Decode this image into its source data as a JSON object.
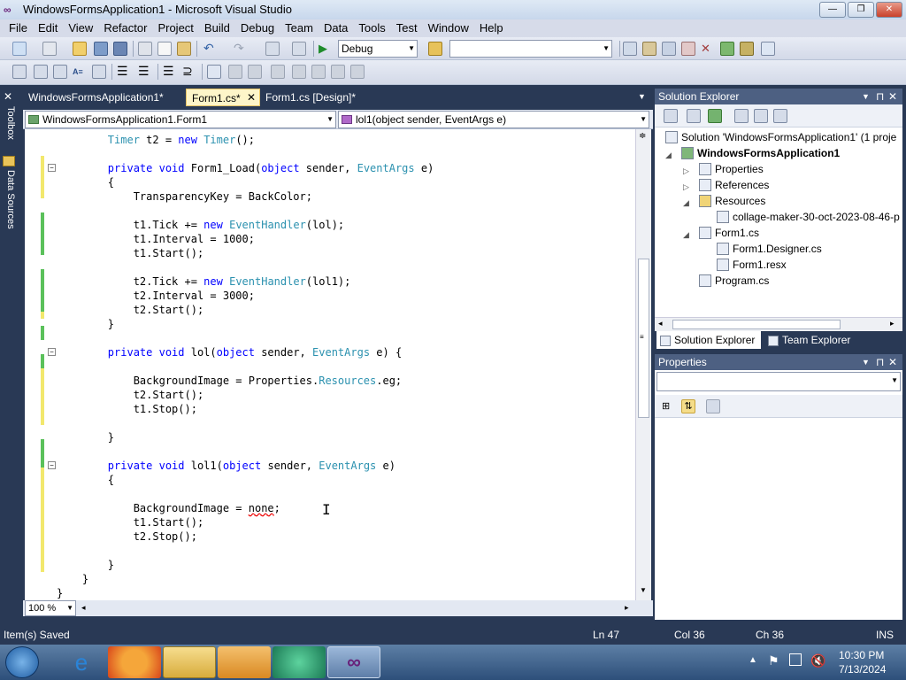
{
  "window": {
    "title": "WindowsFormsApplication1 - Microsoft Visual Studio"
  },
  "menu": [
    "File",
    "Edit",
    "View",
    "Refactor",
    "Project",
    "Build",
    "Debug",
    "Team",
    "Data",
    "Tools",
    "Test",
    "Window",
    "Help"
  ],
  "toolbar": {
    "config": "Debug",
    "platform": ""
  },
  "sidebar": {
    "toolbox": "Toolbox",
    "datasources": "Data Sources"
  },
  "tabs": [
    "WindowsFormsApplication1*",
    "Form1.cs*",
    "Form1.cs [Design]*"
  ],
  "navbar": {
    "class": "WindowsFormsApplication1.Form1",
    "member": "lol1(object sender, EventArgs e)"
  },
  "code": {
    "l0": "        Timer t2 = new Timer();",
    "l2": "        private void Form1_Load(object sender, EventArgs e)",
    "l3": "        {",
    "l4": "            TransparencyKey = BackColor;",
    "l6": "            t1.Tick += new EventHandler(lol);",
    "l7": "            t1.Interval = 1000;",
    "l8": "            t1.Start();",
    "l10": "            t2.Tick += new EventHandler(lol1);",
    "l11": "            t2.Interval = 3000;",
    "l12": "            t2.Start();",
    "l13": "        }",
    "l15": "        private void lol(object sender, EventArgs e) {",
    "l17": "            BackgroundImage = Properties.Resources.eg;",
    "l18": "            t2.Start();",
    "l19": "            t1.Stop();",
    "l21": "        }",
    "l23": "        private void lol1(object sender, EventArgs e)",
    "l24": "        {",
    "l26": "            BackgroundImage = none;",
    "l27": "            t1.Start();",
    "l28": "            t2.Stop();",
    "l30": "        }",
    "l31": "    }",
    "l32": "}"
  },
  "zoom": "100 %",
  "solution_explorer": {
    "title": "Solution Explorer",
    "solution": "Solution 'WindowsFormsApplication1' (1 proje",
    "project": "WindowsFormsApplication1",
    "items": [
      "Properties",
      "References",
      "Resources",
      "collage-maker-30-oct-2023-08-46-p",
      "Form1.cs",
      "Form1.Designer.cs",
      "Form1.resx",
      "Program.cs"
    ],
    "tab1": "Solution Explorer",
    "tab2": "Team Explorer"
  },
  "properties": {
    "title": "Properties"
  },
  "status": {
    "msg": "Item(s) Saved",
    "ln": "Ln 47",
    "col": "Col 36",
    "ch": "Ch 36",
    "mode": "INS"
  },
  "clock": {
    "time": "10:30 PM",
    "date": "7/13/2024"
  },
  "colors": {
    "keyword": "#0000ff",
    "type": "#2b91af",
    "panel_header": "#4d6082",
    "frame": "#293955"
  }
}
